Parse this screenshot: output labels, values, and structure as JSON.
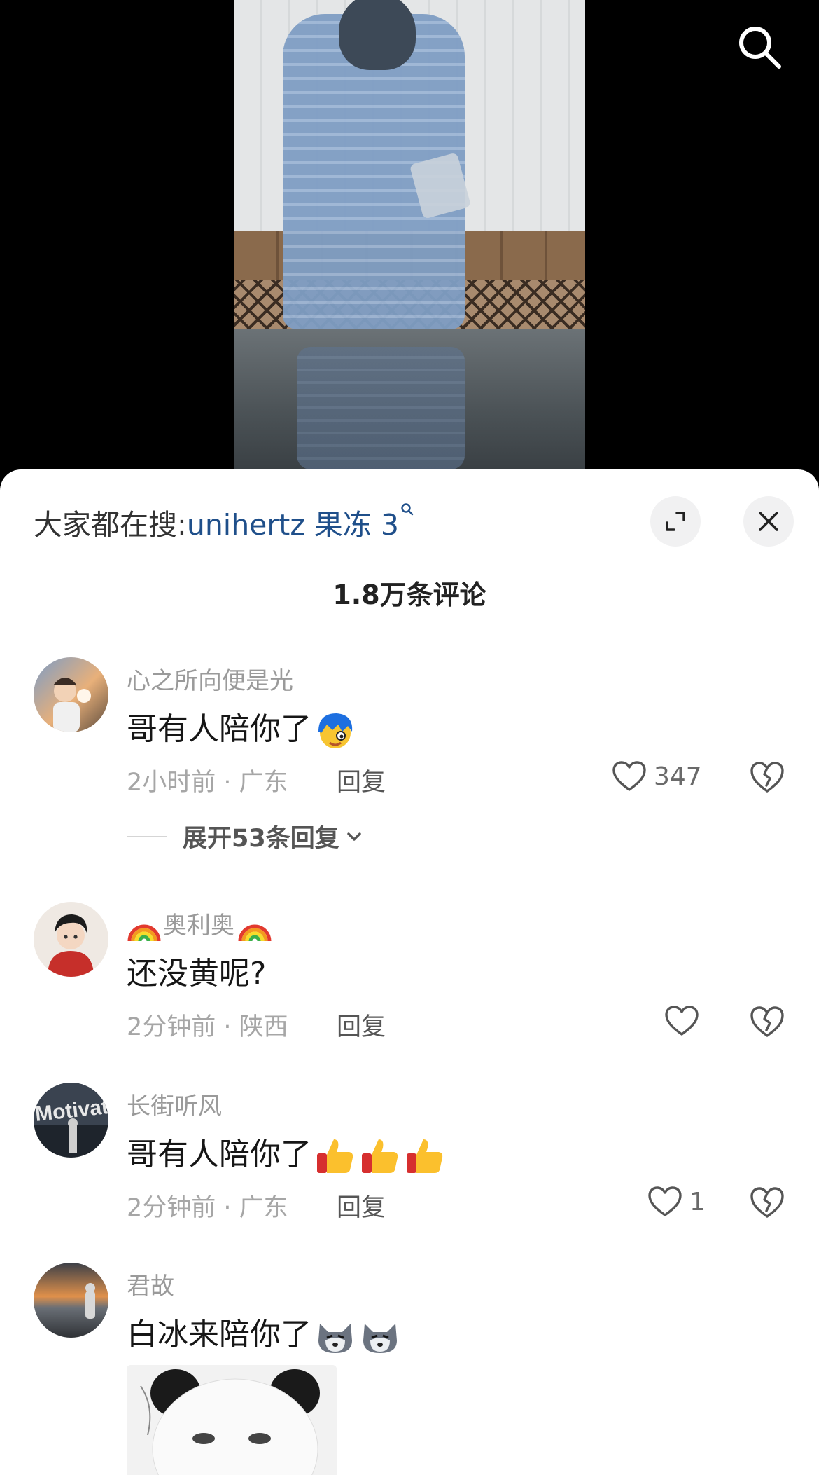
{
  "hot_search": {
    "label": "大家都在搜:",
    "query": "unihertz 果冻 3"
  },
  "comment_count": "1.8万条评论",
  "comments": [
    {
      "user": "心之所向便是光",
      "text": "哥有人陪你了",
      "emojis": [
        "blue-hair-face-emoji"
      ],
      "meta": "2小时前 · 广东",
      "reply": "回复",
      "likes": "347",
      "expand": "展开53条回复"
    },
    {
      "user": "奥利奥",
      "user_emojis": [
        "rainbow-emoji",
        "rainbow-emoji"
      ],
      "text": "还没黄呢?",
      "meta": "2分钟前 · 陕西",
      "reply": "回复",
      "likes": ""
    },
    {
      "user": "长街听风",
      "text": "哥有人陪你了",
      "emojis": [
        "thumbs-up-emoji",
        "thumbs-up-emoji",
        "thumbs-up-emoji"
      ],
      "meta": "2分钟前 · 广东",
      "reply": "回复",
      "likes": "1",
      "avatar_text": "Motivated"
    },
    {
      "user": "君故",
      "text": "白冰来陪你了",
      "emojis": [
        "husky-emoji",
        "husky-emoji"
      ],
      "has_sticker": true
    }
  ],
  "colors": {
    "link": "#1f4f8a",
    "meta": "#a6a6a6"
  }
}
